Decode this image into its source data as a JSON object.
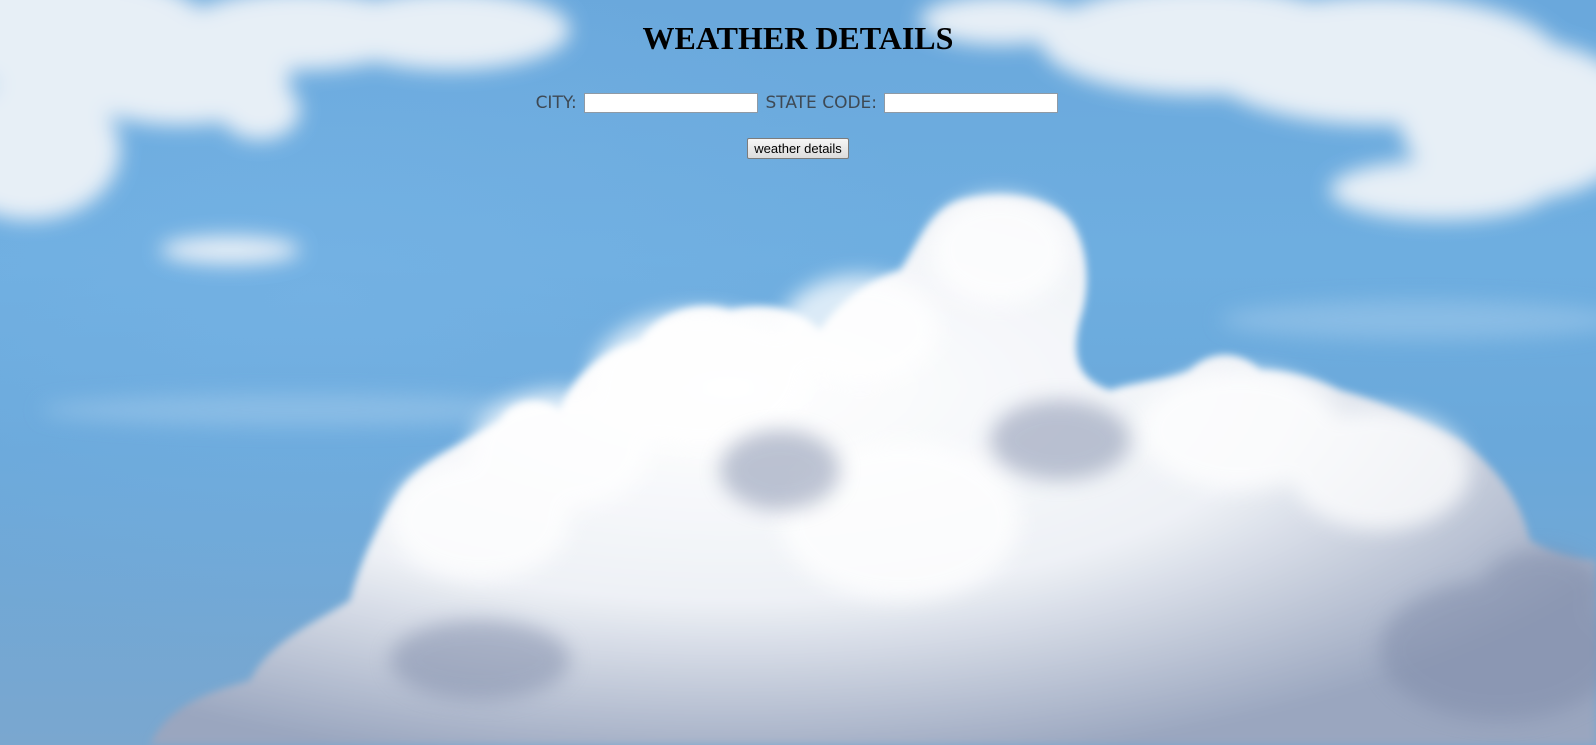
{
  "page": {
    "title": "WEATHER DETAILS"
  },
  "form": {
    "city_label": "CITY:",
    "city_value": "",
    "state_label": "STATE CODE:",
    "state_value": "",
    "submit_label": "weather details"
  },
  "background": {
    "description_icon": "sky-with-clouds-image",
    "sky_color": "#6aa8dc",
    "cloud_color": "#ffffff"
  }
}
